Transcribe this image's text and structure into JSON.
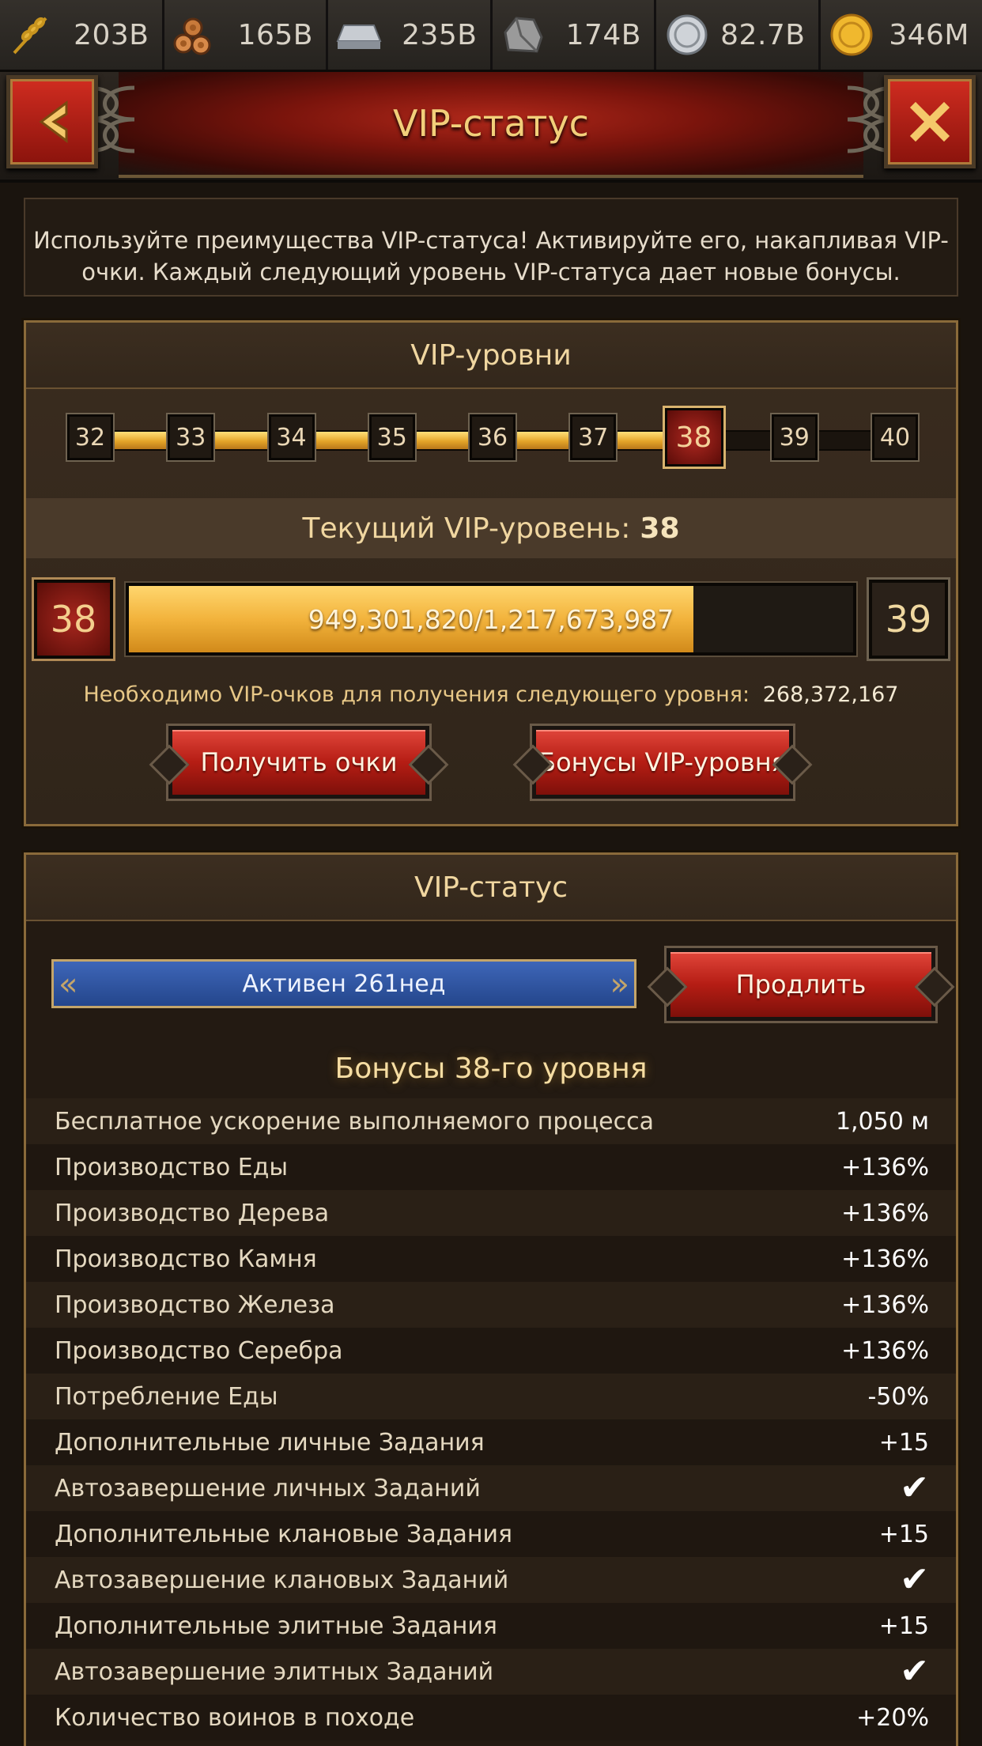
{
  "resources": [
    {
      "icon": "wheat-icon",
      "value": "203B"
    },
    {
      "icon": "wood-logs-icon",
      "value": "165B"
    },
    {
      "icon": "iron-ingot-icon",
      "value": "235B"
    },
    {
      "icon": "stone-icon",
      "value": "174B"
    },
    {
      "icon": "silver-coin-icon",
      "value": "82.7B"
    },
    {
      "icon": "gold-coin-icon",
      "value": "346M"
    }
  ],
  "header": {
    "title": "VIP-статус",
    "back_icon": "‹",
    "close_icon": "X"
  },
  "intro_text": "Используйте преимущества VIP-статуса! Активируйте его, накапливая VIP-очки. Каждый следующий уровень VIP-статуса дает новые бонусы.",
  "levels_panel": {
    "title": "VIP-уровни",
    "track": [
      "32",
      "33",
      "34",
      "35",
      "36",
      "37",
      "38",
      "39",
      "40"
    ],
    "current_index": 6,
    "current_label": "Текущий VIP-уровень:",
    "current_value": "38",
    "from_level": "38",
    "to_level": "39",
    "progress_text": "949,301,820/1,217,673,987",
    "progress_fraction": 0.78,
    "need_label": "Необходимо VIP-очков для получения следующего уровня:",
    "need_value": "268,372,167",
    "get_points_label": "Получить очки",
    "bonuses_label": "Бонусы VIP-уровня"
  },
  "status_panel": {
    "title": "VIP-статус",
    "active_text": "Активен 261нед",
    "extend_label": "Продлить",
    "bonus_title": "Бонусы 38-го уровня",
    "bonuses": [
      {
        "label": "Бесплатное ускорение выполняемого процесса",
        "value": "1,050 м"
      },
      {
        "label": "Производство Еды",
        "value": "+136%"
      },
      {
        "label": "Производство Дерева",
        "value": "+136%"
      },
      {
        "label": "Производство Камня",
        "value": "+136%"
      },
      {
        "label": "Производство Железа",
        "value": "+136%"
      },
      {
        "label": "Производство Серебра",
        "value": "+136%"
      },
      {
        "label": "Потребление Еды",
        "value": "-50%"
      },
      {
        "label": "Дополнительные личные Задания",
        "value": "+15"
      },
      {
        "label": "Автозавершение личных Заданий",
        "value": "✔"
      },
      {
        "label": "Дополнительные клановые Задания",
        "value": "+15"
      },
      {
        "label": "Автозавершение клановых Заданий",
        "value": "✔"
      },
      {
        "label": "Дополнительные элитные Задания",
        "value": "+15"
      },
      {
        "label": "Автозавершение элитных Заданий",
        "value": "✔"
      },
      {
        "label": "Количество воинов в походе",
        "value": "+20%"
      }
    ]
  }
}
